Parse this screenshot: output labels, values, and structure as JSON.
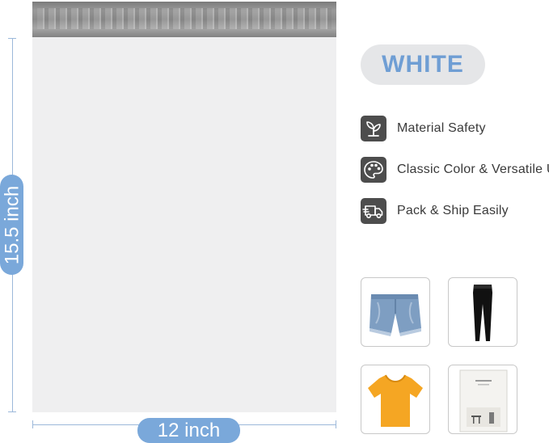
{
  "dimensions": {
    "height_label": "15.5 inch",
    "width_label": "12 inch"
  },
  "color": {
    "name": "WHITE",
    "text_color": "#6f9ed4",
    "pill_bg": "#e5e6e8"
  },
  "features": [
    {
      "icon": "sprout-icon",
      "label": "Material Safety"
    },
    {
      "icon": "palette-icon",
      "label": "Classic Color & Versatile Use"
    },
    {
      "icon": "truck-icon",
      "label": "Pack & Ship Easily"
    }
  ],
  "thumbnails": [
    {
      "icon": "denim-shorts-image"
    },
    {
      "icon": "black-leggings-image"
    },
    {
      "icon": "yellow-tshirt-image"
    },
    {
      "icon": "book-image"
    }
  ],
  "accent_color": "#7aa8da"
}
